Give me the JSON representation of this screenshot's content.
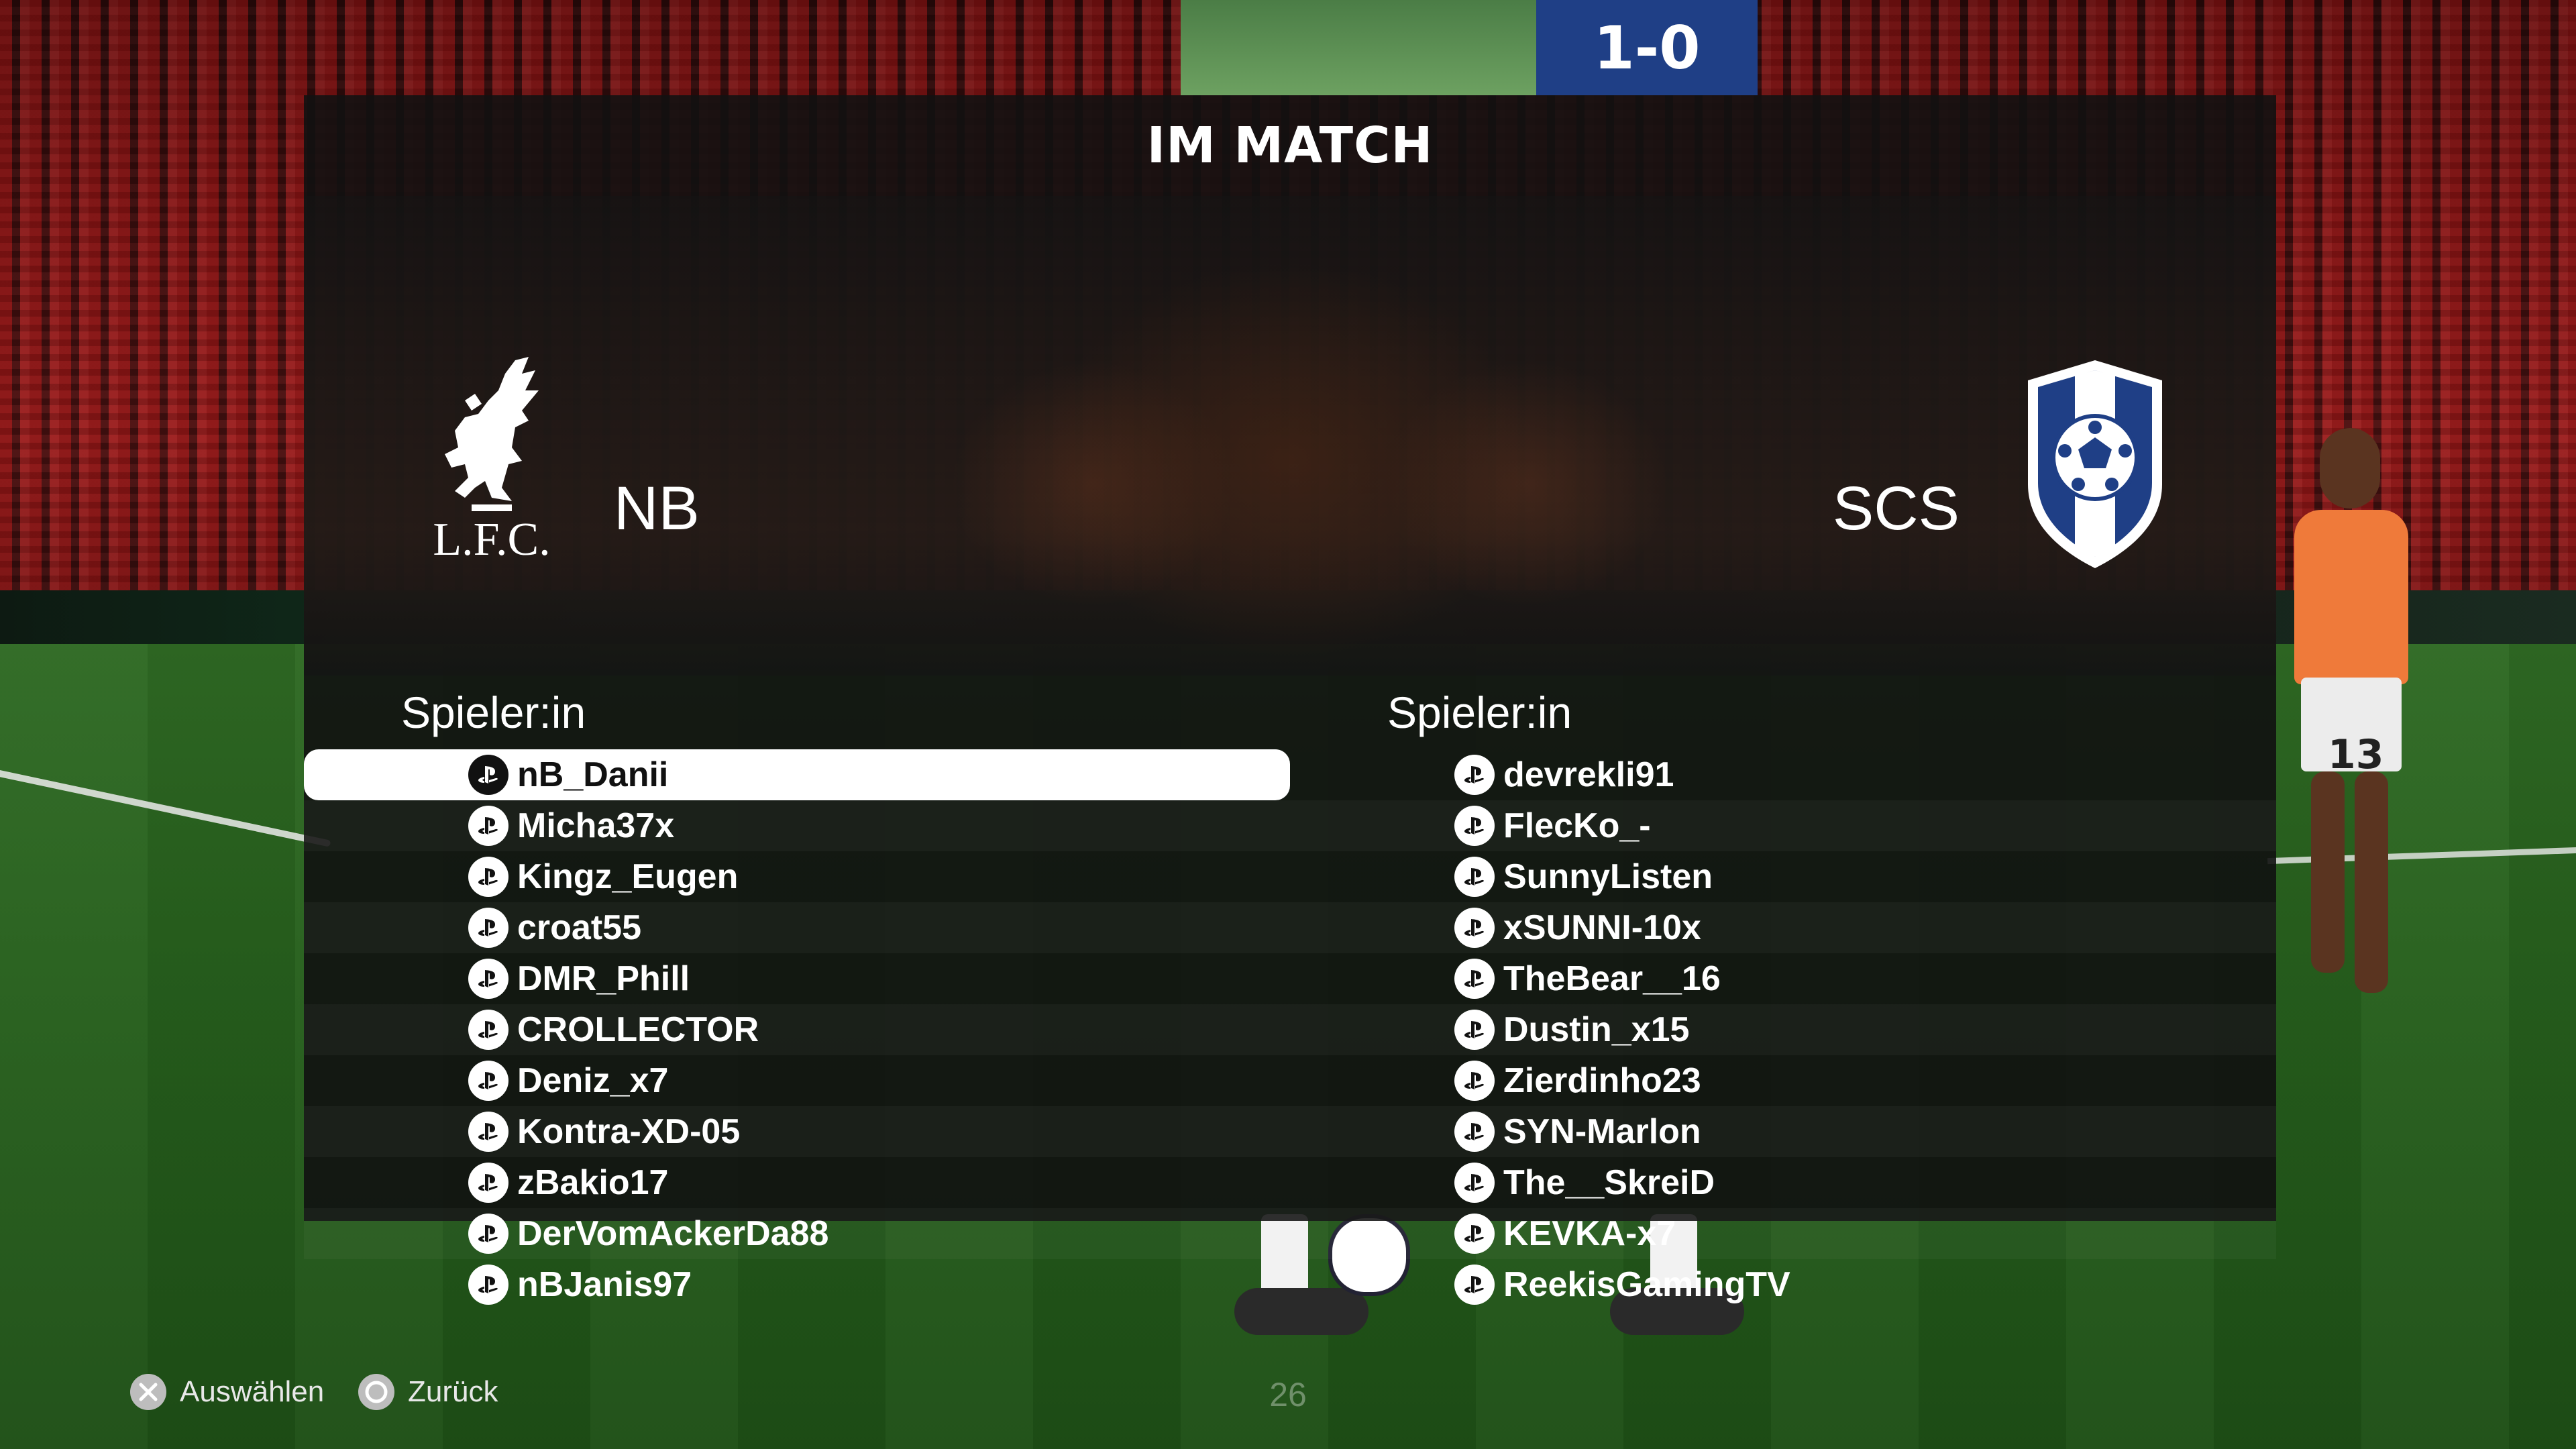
{
  "scoreboard": {
    "score": "1-0"
  },
  "title": "IM MATCH",
  "home_team": {
    "name": "NB",
    "crest_text": "L.F.C."
  },
  "away_team": {
    "name": "SCS"
  },
  "column_header": "Spieler:in",
  "home_players": [
    "nB_Danii",
    "Micha37x",
    "Kingz_Eugen",
    "croat55",
    "DMR_Phill",
    "CROLLECTOR",
    "Deniz_x7",
    "Kontra-XD-05",
    "zBakio17",
    "DerVomAckerDa88",
    "nBJanis97"
  ],
  "away_players": [
    "devrekli91",
    "FlecKo_-",
    "SunnyListen",
    "xSUNNI-10x",
    "TheBear__16",
    "Dustin_x15",
    "Zierdinho23",
    "SYN-Marlon",
    "The__SkreiD",
    "KEVKA-x7",
    "ReekisGamingTV"
  ],
  "selected_player": "nB_Danii",
  "footer": {
    "select_label": "Auswählen",
    "back_label": "Zurück",
    "page_number": "26"
  },
  "player_jersey_number": "13",
  "icons": {
    "platform": "playstation-icon",
    "select": "cross-button-icon",
    "back": "circle-button-icon"
  },
  "colors": {
    "panel": "#111111",
    "selected_row": "#ffffff",
    "away_crest": "#1f3f86",
    "scoreboard": "#1f3f86"
  }
}
